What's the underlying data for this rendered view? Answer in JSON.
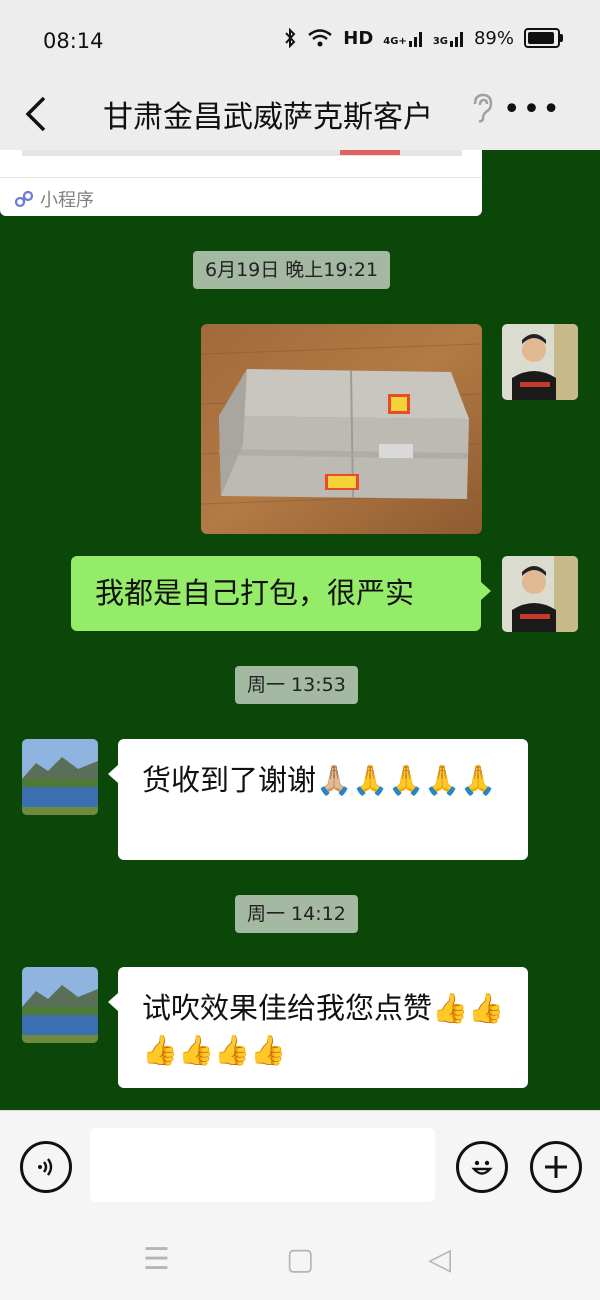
{
  "status": {
    "time": "08:14",
    "network": "HD",
    "sim1": "4G+",
    "sim2": "3G",
    "battery": "89%"
  },
  "header": {
    "title": "甘肃金昌武威萨克斯客户"
  },
  "chat": {
    "mini_program_label": "小程序",
    "messages": [
      {
        "type": "timestamp",
        "text": "6月19日 晚上19:21"
      },
      {
        "type": "image",
        "sender": "me"
      },
      {
        "type": "text",
        "sender": "me",
        "text": "我都是自己打包，很严实"
      },
      {
        "type": "timestamp",
        "text": "周一 13:53"
      },
      {
        "type": "text",
        "sender": "them",
        "text": "货收到了谢谢🙏🏼🙏🙏🙏🙏"
      },
      {
        "type": "timestamp",
        "text": "周一 14:12"
      },
      {
        "type": "text",
        "sender": "them",
        "text": "试吹效果佳给我您点赞👍👍👍👍👍👍"
      }
    ]
  },
  "input": {
    "value": ""
  },
  "colors": {
    "chat_bg": "#0b4708",
    "my_bubble": "#95ec69",
    "their_bubble": "#ffffff",
    "timestamp_bg": "#a4b9a2"
  },
  "icons": [
    "back-icon",
    "ear-icon",
    "more-icon",
    "voice-icon",
    "emoji-icon",
    "plus-icon",
    "mini-program-icon"
  ]
}
